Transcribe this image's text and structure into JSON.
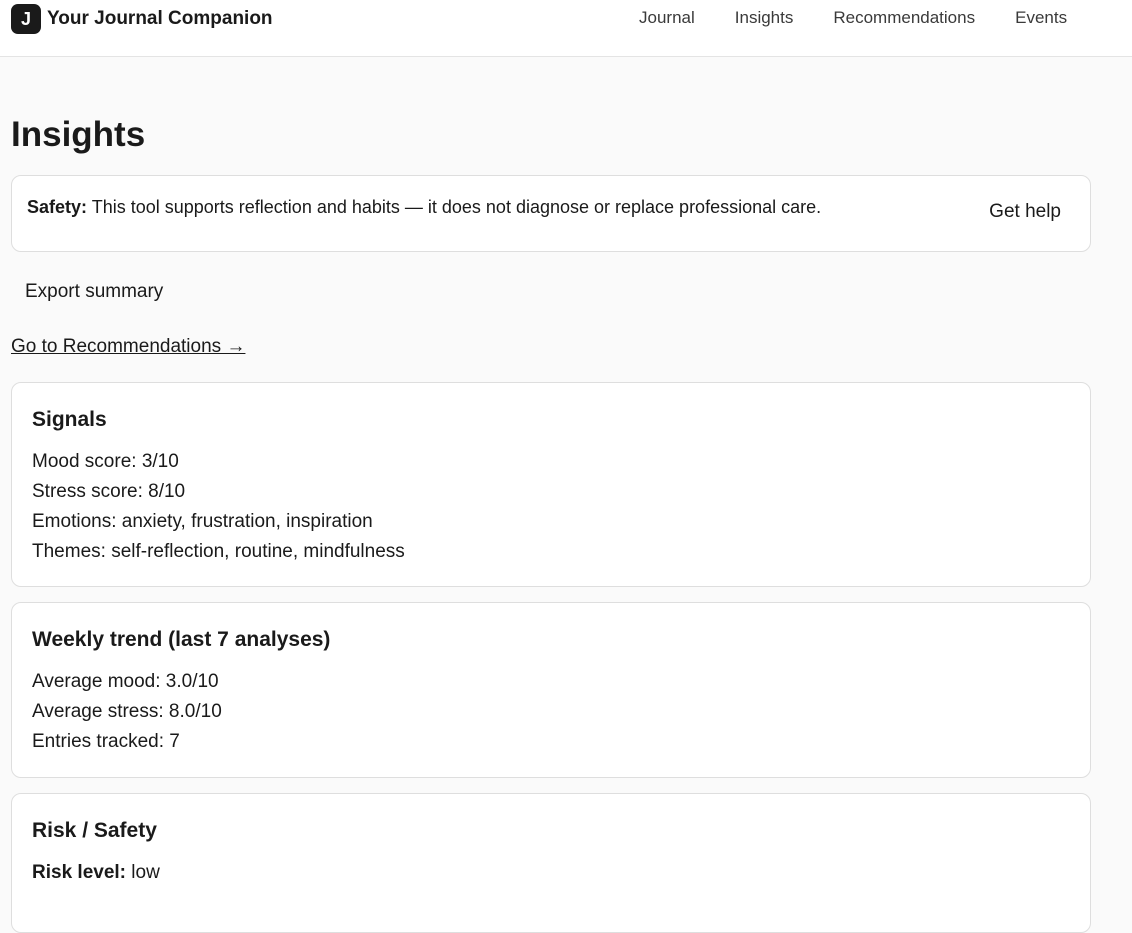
{
  "app": {
    "logo_letter": "J",
    "name": "Your Journal Companion"
  },
  "nav": {
    "items": [
      "Journal",
      "Insights",
      "Recommendations",
      "Events"
    ]
  },
  "page": {
    "title": "Insights"
  },
  "safety": {
    "label": "Safety:",
    "text": "This tool supports reflection and habits — it does not diagnose or replace professional care.",
    "help_button": "Get help"
  },
  "actions": {
    "export_button": "Export summary",
    "recommendations_link": "Go to Recommendations →"
  },
  "signals": {
    "title": "Signals",
    "lines": [
      "Mood score: 3/10",
      "Stress score: 8/10",
      "Emotions: anxiety, frustration, inspiration",
      "Themes: self-reflection, routine, mindfulness"
    ]
  },
  "weekly": {
    "title": "Weekly trend (last 7 analyses)",
    "lines": [
      "Average mood: 3.0/10",
      "Average stress: 8.0/10",
      "Entries tracked: 7"
    ]
  },
  "risk": {
    "title": "Risk / Safety",
    "level_label": "Risk level:",
    "level_value": "low"
  }
}
